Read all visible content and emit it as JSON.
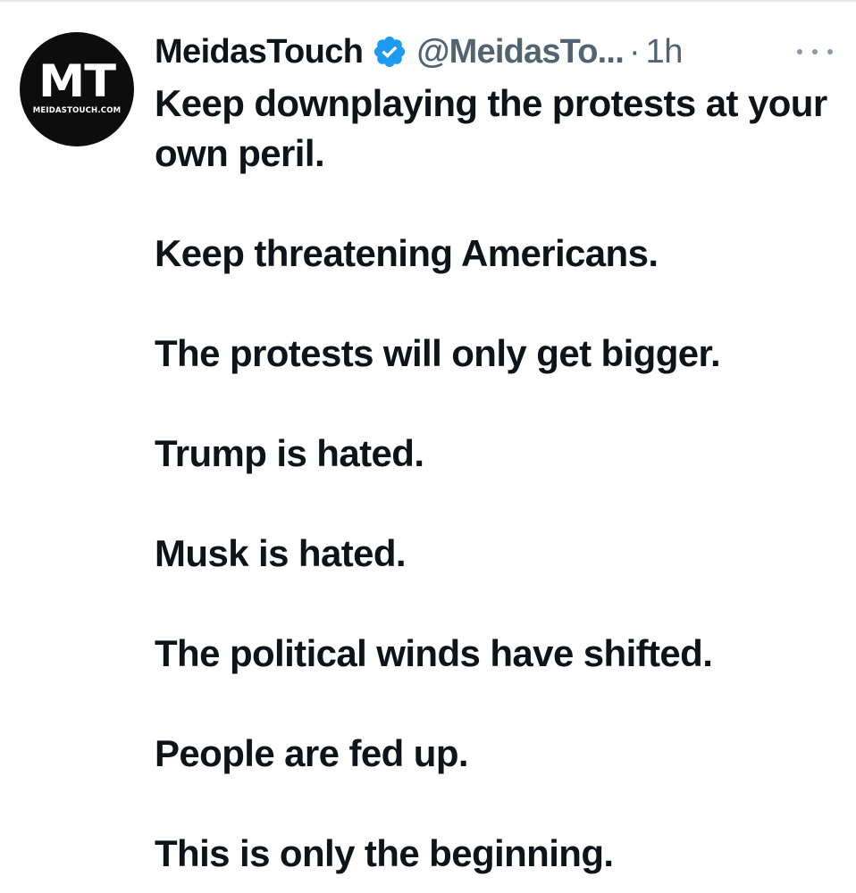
{
  "author": {
    "display_name": "MeidasTouch",
    "handle": "@MeidasTo...",
    "separator": "·",
    "time": "1h",
    "avatar_initials": "MT",
    "avatar_domain": "MEIDASTOUCH.COM",
    "verified_icon": "verified-badge-icon",
    "verified_color": "#1d9bf0"
  },
  "more_icon": "more-horizontal-icon",
  "tweet": {
    "paragraphs": [
      "Keep downplaying the protests at your own peril.",
      "Keep threatening Americans.",
      "The protests will only get bigger.",
      "Trump is hated.",
      "Musk is hated.",
      "The political winds have shifted.",
      "People are fed up.",
      "This is only the beginning."
    ]
  },
  "colors": {
    "text": "#0f1419",
    "secondary": "#536471",
    "accent": "#1d9bf0"
  }
}
